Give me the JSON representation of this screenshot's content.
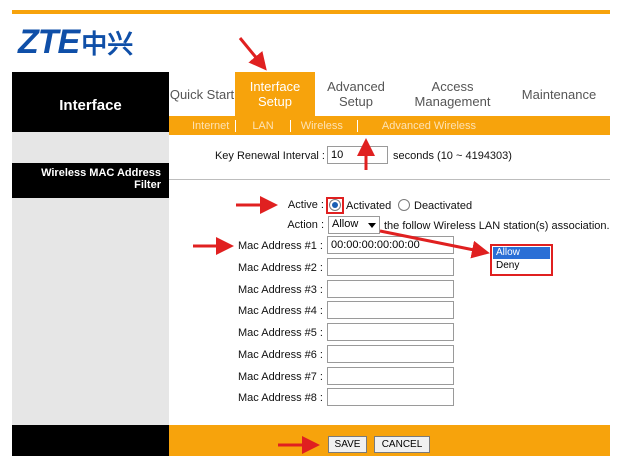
{
  "logo": {
    "brand": "ZTE",
    "brand_cn": "中兴"
  },
  "sidebar": {
    "title": "Interface",
    "section_title": "Wireless MAC Address Filter"
  },
  "nav": {
    "tabs": [
      {
        "label": "Quick Start"
      },
      {
        "label": "Interface Setup"
      },
      {
        "label": "Advanced Setup"
      },
      {
        "label": "Access Management"
      },
      {
        "label": "Maintenance"
      }
    ],
    "subtabs": [
      {
        "label": "Internet"
      },
      {
        "label": "LAN"
      },
      {
        "label": "Wireless"
      },
      {
        "label": "Advanced Wireless"
      }
    ]
  },
  "form": {
    "key_renewal": {
      "label": "Key Renewal Interval :",
      "value": "10",
      "unit": "seconds  (10 ~ 4194303)"
    },
    "active": {
      "label": "Active :",
      "option_on": "Activated",
      "option_off": "Deactivated",
      "selected": "Activated"
    },
    "action": {
      "label": "Action :",
      "value": "Allow",
      "suffix": "the follow Wireless LAN station(s) association."
    },
    "mac_addresses": [
      {
        "label": "Mac Address #1 :",
        "value": "00:00:00:00:00:00"
      },
      {
        "label": "Mac Address #2 :",
        "value": ""
      },
      {
        "label": "Mac Address #3 :",
        "value": ""
      },
      {
        "label": "Mac Address #4 :",
        "value": ""
      },
      {
        "label": "Mac Address #5 :",
        "value": ""
      },
      {
        "label": "Mac Address #6 :",
        "value": ""
      },
      {
        "label": "Mac Address #7 :",
        "value": ""
      },
      {
        "label": "Mac Address #8 :",
        "value": ""
      }
    ],
    "dropdown_options": [
      "Allow",
      "Deny"
    ]
  },
  "buttons": {
    "save": "SAVE",
    "cancel": "CANCEL"
  },
  "colors": {
    "accent": "#f7a30c",
    "brand": "#0f4fa8",
    "highlight": "#e02020"
  }
}
